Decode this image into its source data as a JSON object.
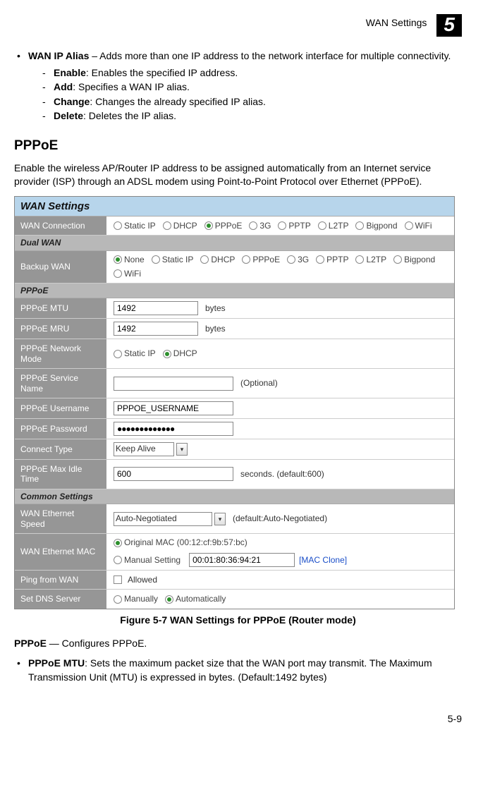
{
  "header": {
    "title": "WAN Settings",
    "chapter": "5"
  },
  "intro": {
    "wan_ip_alias_label": "WAN IP Alias",
    "wan_ip_alias_text": " – Adds more than one IP address to the network interface for multiple connectivity.",
    "sub": {
      "enable_l": "Enable",
      "enable_t": ": Enables the specified IP address.",
      "add_l": "Add",
      "add_t": ": Specifies a WAN IP alias.",
      "change_l": "Change",
      "change_t": ": Changes the already specified IP alias.",
      "delete_l": "Delete",
      "delete_t": ": Deletes the IP alias."
    }
  },
  "pppoe_section": {
    "heading": "PPPoE",
    "para": "Enable the wireless AP/Router IP address to be assigned automatically from an Internet service provider (ISP) through an ADSL modem using Point-to-Point Protocol over Ethernet (PPPoE)."
  },
  "scr": {
    "title": "WAN Settings",
    "wan_conn": {
      "label": "WAN Connection",
      "opts": [
        "Static IP",
        "DHCP",
        "PPPoE",
        "3G",
        "PPTP",
        "L2TP",
        "Bigpond",
        "WiFi"
      ],
      "selected": "PPPoE"
    },
    "dual_wan_section": "Dual WAN",
    "backup_wan": {
      "label": "Backup WAN",
      "opts": [
        "None",
        "Static IP",
        "DHCP",
        "PPPoE",
        "3G",
        "PPTP",
        "L2TP",
        "Bigpond",
        "WiFi"
      ],
      "selected": "None"
    },
    "pppoe_section": "PPPoE",
    "mtu": {
      "label": "PPPoE MTU",
      "value": "1492",
      "unit": "bytes"
    },
    "mru": {
      "label": "PPPoE MRU",
      "value": "1492",
      "unit": "bytes"
    },
    "netmode": {
      "label": "PPPoE Network Mode",
      "opts": [
        "Static IP",
        "DHCP"
      ],
      "selected": "DHCP"
    },
    "svc": {
      "label": "PPPoE Service Name",
      "value": "",
      "suffix": "(Optional)"
    },
    "user": {
      "label": "PPPoE Username",
      "value": "PPPOE_USERNAME"
    },
    "pass": {
      "label": "PPPoE Password",
      "value": "●●●●●●●●●●●●●"
    },
    "connecttype": {
      "label": "Connect Type",
      "value": "Keep Alive"
    },
    "maxidle": {
      "label": "PPPoE Max Idle Time",
      "value": "600",
      "suffix": "seconds. (default:600)"
    },
    "common_section": "Common Settings",
    "ethspeed": {
      "label": "WAN Ethernet Speed",
      "value": "Auto-Negotiated",
      "suffix": "(default:Auto-Negotiated)"
    },
    "ethmac": {
      "label": "WAN Ethernet MAC",
      "orig_label": "Original MAC (00:12:cf:9b:57:bc)",
      "manual_label": "Manual Setting",
      "manual_value": "00:01:80:36:94:21",
      "clone_link": "[MAC Clone]",
      "selected": "orig"
    },
    "ping": {
      "label": "Ping from WAN",
      "check_label": "Allowed"
    },
    "dns": {
      "label": "Set DNS Server",
      "opts": [
        "Manually",
        "Automatically"
      ],
      "selected": "Automatically"
    }
  },
  "caption": "Figure 5-7  WAN Settings for PPPoE (Router mode)",
  "desc": {
    "pppoe_l": "PPPoE",
    "pppoe_t": " — Configures PPPoE.",
    "mtu_l": "PPPoE MTU",
    "mtu_t": ": Sets the maximum packet size that the WAN port may transmit. The Maximum Transmission Unit (MTU) is expressed in bytes. (Default:1492 bytes)"
  },
  "page_num": "5-9"
}
